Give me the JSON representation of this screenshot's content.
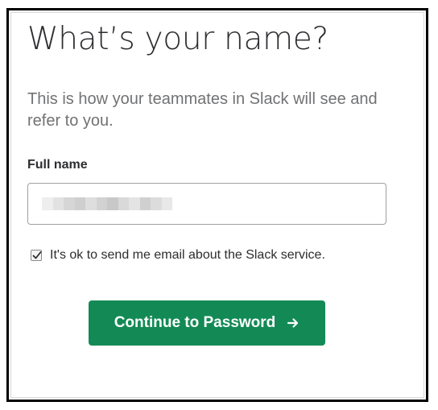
{
  "page": {
    "title": "What’s your name?",
    "subtitle": "This is how your teammates in Slack will see and refer to you."
  },
  "form": {
    "full_name_label": "Full name",
    "full_name_value_redacted": true,
    "email_opt_in_label": "It's ok to send me email about the Slack service.",
    "email_opt_in_checked": true,
    "continue_button_label": "Continue to Password",
    "continue_button_icon": "arrow-right-icon"
  },
  "colors": {
    "button_bg": "#138a55",
    "title_text": "#2c2d30",
    "subtitle_text": "#717274"
  }
}
